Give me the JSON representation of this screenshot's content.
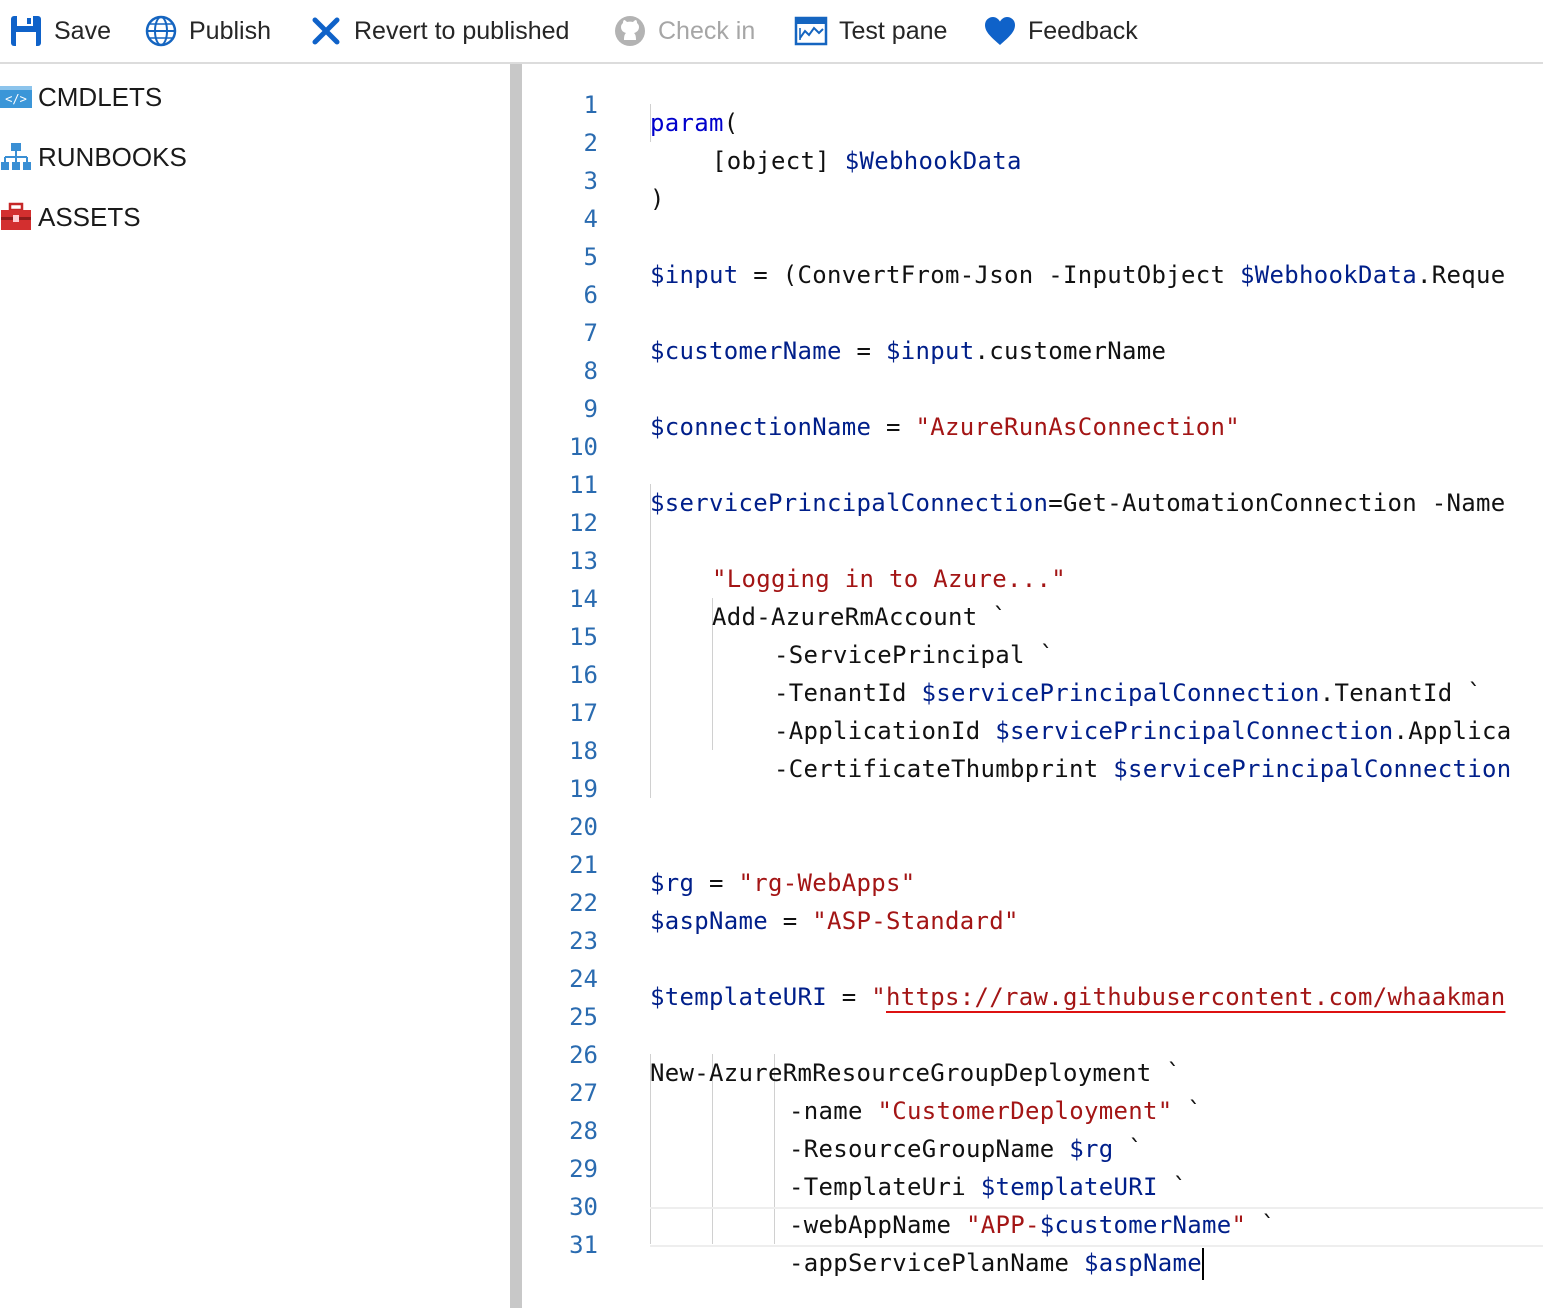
{
  "toolbar": {
    "save": "Save",
    "publish": "Publish",
    "revert": "Revert to published",
    "checkin": "Check in",
    "testpane": "Test pane",
    "feedback": "Feedback"
  },
  "sidebar": {
    "items": [
      {
        "label": "CMDLETS",
        "icon": "code-icon"
      },
      {
        "label": "RUNBOOKS",
        "icon": "hierarchy-icon"
      },
      {
        "label": "ASSETS",
        "icon": "toolbox-icon"
      }
    ]
  },
  "editor": {
    "line_numbers": [
      "1",
      "2",
      "3",
      "4",
      "5",
      "6",
      "7",
      "8",
      "9",
      "10",
      "11",
      "12",
      "13",
      "14",
      "15",
      "16",
      "17",
      "18",
      "19",
      "20",
      "21",
      "22",
      "23",
      "24",
      "25",
      "26",
      "27",
      "28",
      "29",
      "30",
      "31"
    ],
    "lines": {
      "l1_kw": "param",
      "l1_rest": "(",
      "l2_type": "[object] ",
      "l2_var": "$WebhookData",
      "l3": ")",
      "l5_var": "$input",
      "l5_mid": " = (ConvertFrom-Json -InputObject ",
      "l5_var2": "$WebhookData",
      "l5_rest": ".Reque",
      "l7_var": "$customerName",
      "l7_mid": " = ",
      "l7_var2": "$input",
      "l7_rest": ".customerName",
      "l9_var": "$connectionName",
      "l9_mid": " = ",
      "l9_str": "\"AzureRunAsConnection\"",
      "l11_var": "$servicePrincipalConnection",
      "l11_rest": "=Get-AutomationConnection -Name",
      "l13_str": "\"Logging in to Azure...\"",
      "l14": "Add-AzureRmAccount `",
      "l15": "-ServicePrincipal `",
      "l16_a": "-TenantId ",
      "l16_var": "$servicePrincipalConnection",
      "l16_rest": ".TenantId `",
      "l17_a": "-ApplicationId ",
      "l17_var": "$servicePrincipalConnection",
      "l17_rest": ".Applica",
      "l18_a": "-CertificateThumbprint ",
      "l18_var": "$servicePrincipalConnection",
      "l21_var": "$rg",
      "l21_mid": " = ",
      "l21_str": "\"rg-WebApps\"",
      "l22_var": "$aspName",
      "l22_mid": " = ",
      "l22_str": "\"ASP-Standard\"",
      "l24_var": "$templateURI",
      "l24_mid": " = ",
      "l24_q": "\"",
      "l24_url": "https://raw.githubusercontent.com/whaakman",
      "l26": "New-AzureRmResourceGroupDeployment `",
      "l27_a": "-name ",
      "l27_str": "\"CustomerDeployment\"",
      "l27_rest": " `",
      "l28_a": "-ResourceGroupName ",
      "l28_var": "$rg",
      "l28_rest": " `",
      "l29_a": "-TemplateUri ",
      "l29_var": "$templateURI",
      "l29_rest": " `",
      "l30_a": "-webAppName ",
      "l30_str1": "\"APP-",
      "l30_var": "$customerName",
      "l30_str2": "\"",
      "l30_rest": " `",
      "l31_a": "-appServicePlanName ",
      "l31_var": "$aspName"
    }
  },
  "colors": {
    "accent": "#0078d4",
    "keyword": "#0000cc",
    "variable": "#001f8a",
    "string": "#a31515",
    "line_number": "#2a6bb0"
  }
}
